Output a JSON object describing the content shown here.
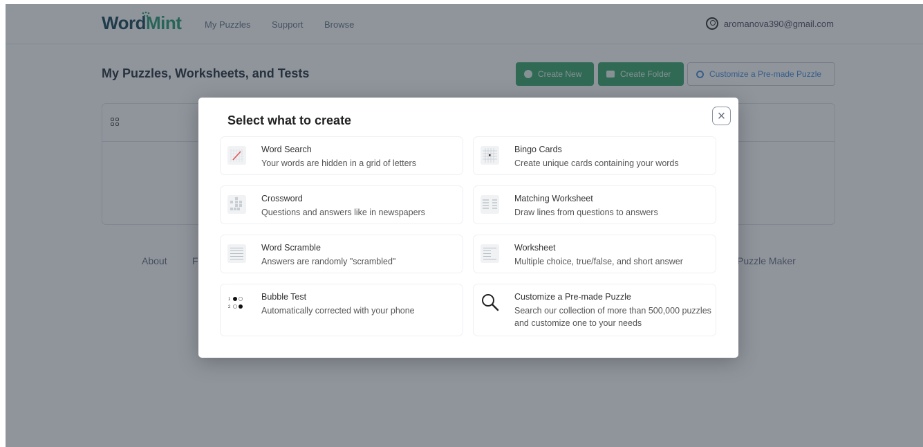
{
  "header": {
    "logo_word": "Word",
    "logo_mint": "Mint",
    "nav": [
      "My Puzzles",
      "Support",
      "Browse"
    ],
    "account_email": "aromanova390@gmail.com"
  },
  "main": {
    "title": "My Puzzles, Worksheets, and Tests",
    "create_new_label": "Create New",
    "create_folder_label": "Create Folder",
    "customize_label": "Customize a Pre-made Puzzle"
  },
  "footer": {
    "about": "About",
    "partial_left": "F",
    "partial_right": "Puzzle Maker"
  },
  "modal": {
    "title": "Select what to create",
    "close_symbol": "×",
    "options": [
      {
        "name": "Word Search",
        "desc": "Your words are hidden in a grid of letters",
        "icon": "word-search-thumb"
      },
      {
        "name": "Bingo Cards",
        "desc": "Create unique cards containing your words",
        "icon": "bingo-thumb"
      },
      {
        "name": "Crossword",
        "desc": "Questions and answers like in newspapers",
        "icon": "crossword-thumb"
      },
      {
        "name": "Matching Worksheet",
        "desc": "Draw lines from questions to answers",
        "icon": "matching-thumb"
      },
      {
        "name": "Word Scramble",
        "desc": "Answers are randomly \"scrambled\"",
        "icon": "scramble-thumb"
      },
      {
        "name": "Worksheet",
        "desc": "Multiple choice, true/false, and short answer",
        "icon": "worksheet-thumb"
      },
      {
        "name": "Bubble Test",
        "desc": "Automatically corrected with your phone",
        "icon": "bubble-thumb"
      },
      {
        "name": "Customize a Pre-made Puzzle",
        "desc": "Search our collection of more than 500,000 puzzles and customize one to your needs",
        "icon": "search-icon"
      }
    ]
  },
  "colors": {
    "accent_green": "#3fa66e",
    "link_blue": "#4d8fd8",
    "logo_dark": "#1f4d5c",
    "logo_green": "#2e9e78"
  }
}
